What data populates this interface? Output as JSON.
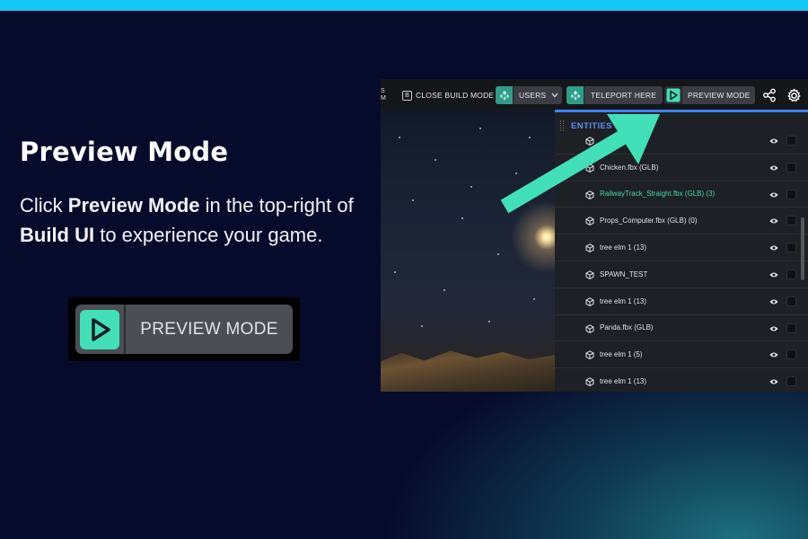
{
  "title": "Preview Mode",
  "description": {
    "p1": "Click ",
    "b1": "Preview Mode",
    "p2": " in the top-right of ",
    "b2": "Build UI",
    "p3": " to experience your game."
  },
  "badge": {
    "label": "PREVIEW MODE",
    "icon": "play-icon"
  },
  "screenshot": {
    "toolbar": {
      "clipped_text_1": "S",
      "clipped_text_2": "M",
      "close_key": "B",
      "close_label": "CLOSE BUILD MODE",
      "users_label": "USERS",
      "teleport_label": "TELEPORT HERE",
      "preview_label": "PREVIEW MODE",
      "share_icon": "share-icon",
      "settings_icon": "gear-icon"
    },
    "panel": {
      "title": "ENTITIES",
      "rows": [
        {
          "name": ""
        },
        {
          "name": "Chicken.fbx (GLB)"
        },
        {
          "name": "RailwayTrack_Straight.fbx (GLB) (3)",
          "highlighted": true
        },
        {
          "name": "Props_Computer.fbx (GLB) (0)"
        },
        {
          "name": "tree elm 1 (13)"
        },
        {
          "name": "SPAWN_TEST"
        },
        {
          "name": "tree elm 1 (13)"
        },
        {
          "name": "Panda.fbx (GLB)"
        },
        {
          "name": "tree elm 1 (5)"
        },
        {
          "name": "tree elm 1 (13)"
        }
      ]
    }
  },
  "colors": {
    "accent": "#42e0b8",
    "top_bar": "#14c8f5",
    "panel_title": "#5a8dff",
    "background": "#070b2b"
  }
}
